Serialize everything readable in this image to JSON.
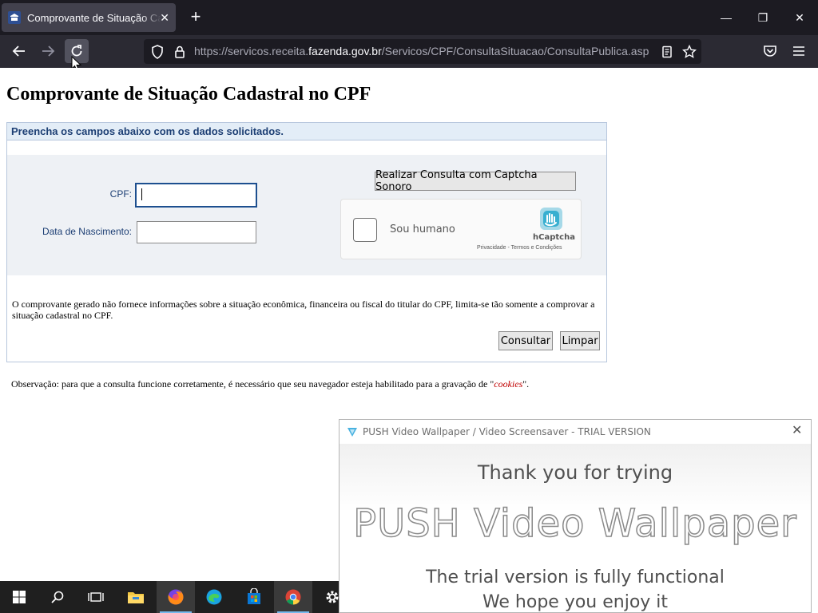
{
  "browser": {
    "tab_title": "Comprovante de Situação Cadastral no CPF",
    "tab_close": "✕",
    "new_tab": "+",
    "url_prefix": "https://servicos.receita.",
    "url_domain": "fazenda.gov.br",
    "url_path": "/Servicos/CPF/ConsultaSituacao/ConsultaPublica.asp",
    "window_controls": {
      "minimize": "—",
      "maximize": "❐",
      "close": "✕"
    }
  },
  "page": {
    "title": "Comprovante de Situação Cadastral no CPF",
    "form_header": "Preencha os campos abaixo com os dados solicitados.",
    "cpf_label": "CPF:",
    "cpf_value": "",
    "birth_label": "Data de Nascimento:",
    "birth_value": "",
    "audio_captcha_button": "Realizar Consulta com Captcha Sonoro",
    "hcaptcha": {
      "label": "Sou humano",
      "brand": "hCaptcha",
      "links": "Privacidade - Termos e Condições"
    },
    "disclaimer": "O comprovante gerado não fornece informações sobre a situação econômica, financeira ou fiscal do titular do CPF, limita-se tão somente a comprovar a situação cadastral no CPF.",
    "submit_button": "Consultar",
    "clear_button": "Limpar",
    "note_before": "Observação: para que a consulta funcione corretamente, é necessário que seu navegador esteja habilitado para a gravação de \"",
    "note_cookies": "cookies",
    "note_after": "\"."
  },
  "popup": {
    "title": "PUSH Video Wallpaper / Video Screensaver - TRIAL VERSION",
    "close": "✕",
    "thanks": "Thank you for trying",
    "product": "PUSH Video Wallpaper",
    "line1": "The trial version is fully functional",
    "line2": "We hope you enjoy it"
  },
  "taskbar": {
    "items": [
      "start",
      "search",
      "task-view",
      "file-explorer",
      "firefox",
      "edge",
      "microsoft-store",
      "chrome",
      "settings"
    ],
    "active": "firefox"
  }
}
